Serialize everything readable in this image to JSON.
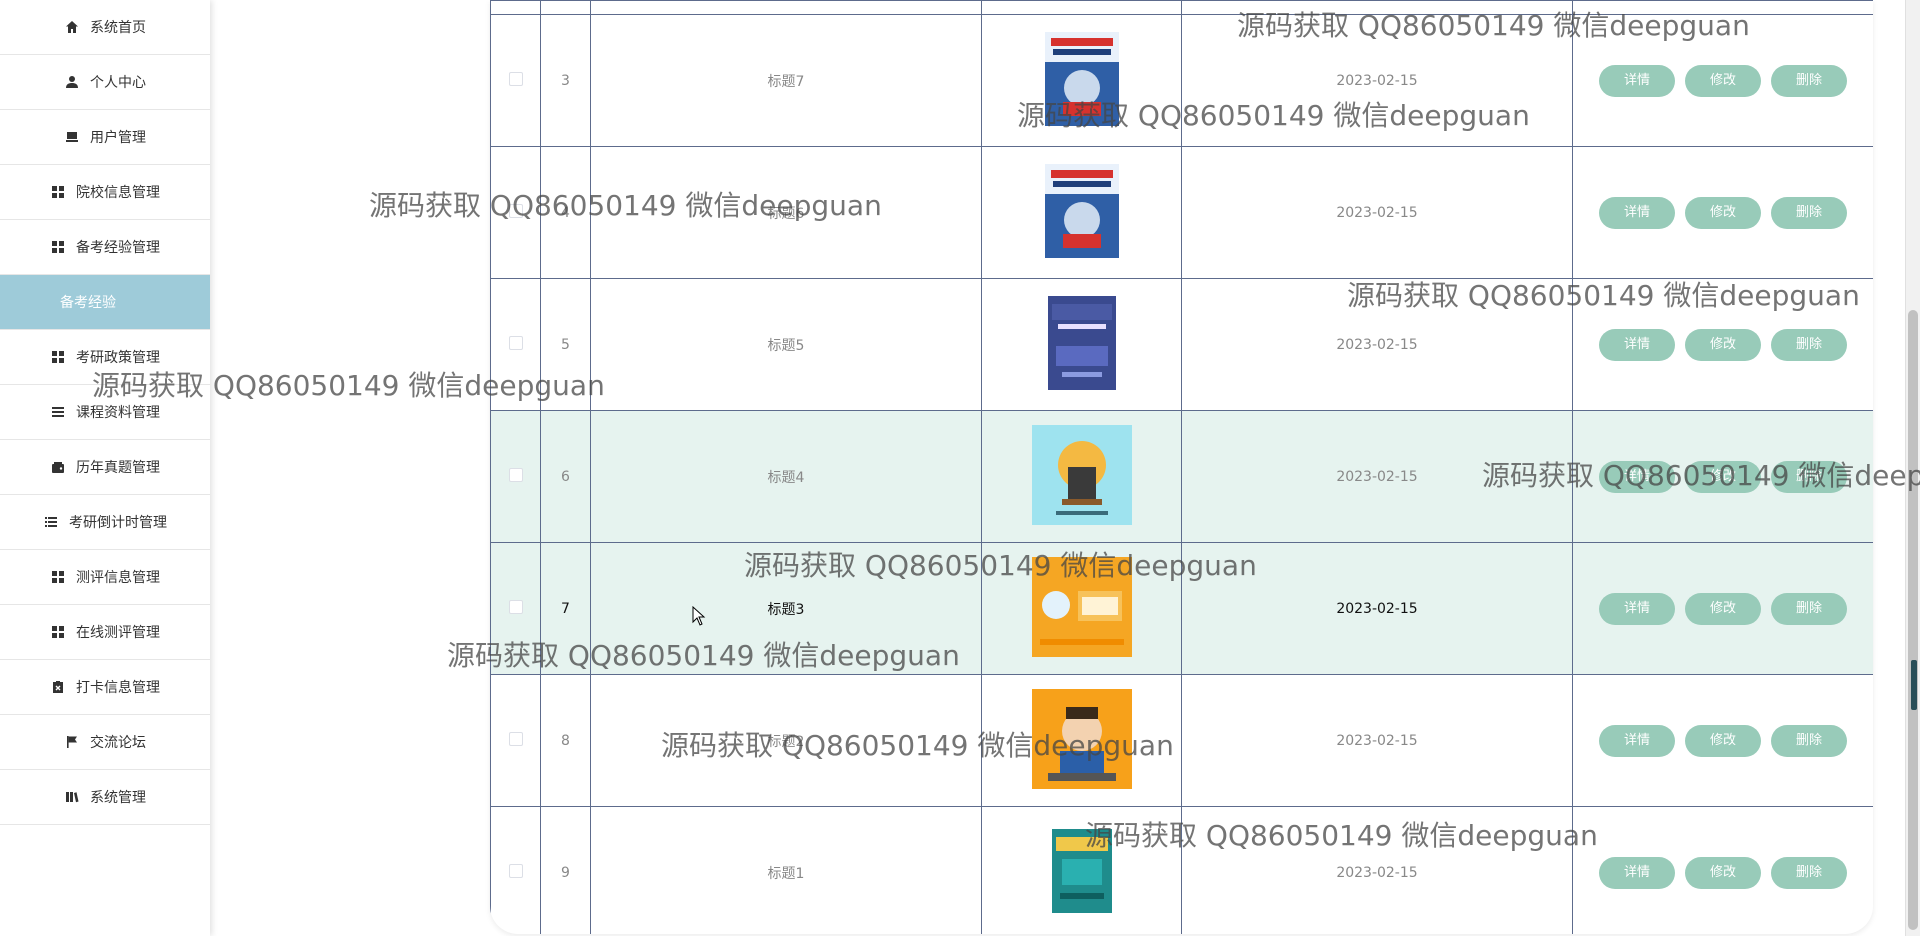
{
  "sidebar": {
    "items": [
      {
        "label": "系统首页",
        "icon": "home-icon"
      },
      {
        "label": "个人中心",
        "icon": "user-icon"
      },
      {
        "label": "用户管理",
        "icon": "monitor-icon"
      },
      {
        "label": "院校信息管理",
        "icon": "grid-icon"
      },
      {
        "label": "备考经验管理",
        "icon": "grid-icon"
      },
      {
        "label": "备考经验",
        "icon": "",
        "active": true
      },
      {
        "label": "考研政策管理",
        "icon": "grid-icon"
      },
      {
        "label": "课程资料管理",
        "icon": "list-icon"
      },
      {
        "label": "历年真题管理",
        "icon": "wallet-icon"
      },
      {
        "label": "考研倒计时管理",
        "icon": "list-icon"
      },
      {
        "label": "测评信息管理",
        "icon": "grid-icon"
      },
      {
        "label": "在线测评管理",
        "icon": "grid-icon"
      },
      {
        "label": "打卡信息管理",
        "icon": "clipboard-icon"
      },
      {
        "label": "交流论坛",
        "icon": "flag-icon"
      },
      {
        "label": "系统管理",
        "icon": "book-icon"
      }
    ]
  },
  "table": {
    "buttons": {
      "detail": "详情",
      "edit": "修改",
      "delete": "删除"
    },
    "rows": [
      {
        "index": "3",
        "title": "标题7",
        "date": "2023-02-15",
        "cover": "book-red"
      },
      {
        "index": "4",
        "title": "标题6",
        "date": "2023-02-15",
        "cover": "book-red"
      },
      {
        "index": "5",
        "title": "标题5",
        "date": "2023-02-15",
        "cover": "book-python"
      },
      {
        "index": "6",
        "title": "标题4",
        "date": "2023-02-15",
        "cover": "book-cyan",
        "highlight": true
      },
      {
        "index": "7",
        "title": "标题3",
        "date": "2023-02-15",
        "cover": "book-orange",
        "highlight": true,
        "bold": true
      },
      {
        "index": "8",
        "title": "标题2",
        "date": "2023-02-15",
        "cover": "book-cartoon"
      },
      {
        "index": "9",
        "title": "标题1",
        "date": "2023-02-15",
        "cover": "book-teal"
      }
    ]
  },
  "watermark": {
    "text": "源码获取 QQ86050149 微信deepguan"
  },
  "colors": {
    "accent": "#9ecbd9",
    "button": "#98cbb9",
    "highlight": "#e6f3ef",
    "border": "#5d6b8c"
  }
}
